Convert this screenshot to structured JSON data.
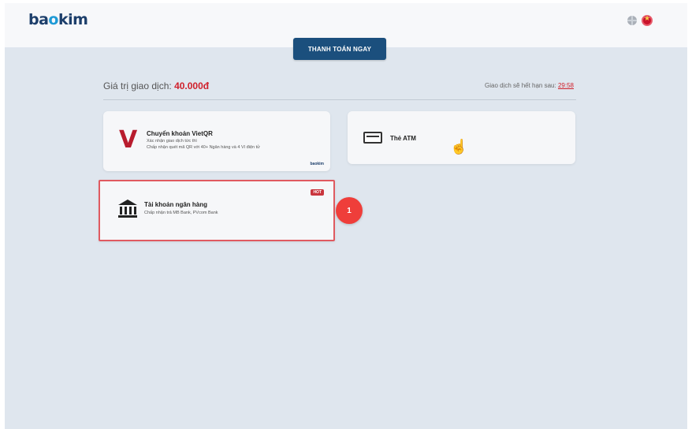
{
  "header": {
    "logo_left": "ba",
    "logo_dot": "o",
    "logo_right": "kim",
    "icons": [
      "globe-icon",
      "vietnam-flag-icon"
    ]
  },
  "pay_button": {
    "label": "THANH TOÁN NGAY"
  },
  "transaction": {
    "amount_label": "Giá trị giao dịch:",
    "amount_value": "40.000đ",
    "expire_label": "Giao dịch sẽ hết hạn sau:",
    "expire_timer": "29:58"
  },
  "methods": {
    "vietqr": {
      "title": "Chuyển khoản VietQR",
      "sub1": "Xác nhận giao dịch tức thì",
      "sub2": "Chấp nhận quét mã QR với 40+ Ngân hàng và 4 Ví điện tử",
      "brand": "baokim",
      "icon": "vietqr-v-icon"
    },
    "atm": {
      "title": "Thẻ ATM",
      "icon": "atm-card-icon"
    },
    "bank": {
      "title": "Tài khoản ngân hàng",
      "sub": "Chấp nhận trả MB Bank, PVcom Bank",
      "badge": "HOT",
      "icon": "bank-building-icon"
    }
  },
  "step_marker": "1",
  "colors": {
    "brand_navy": "#1b4f7d",
    "accent_red": "#d0202b",
    "highlight_border": "#e05a60",
    "step_badge": "#ef3e3a"
  }
}
